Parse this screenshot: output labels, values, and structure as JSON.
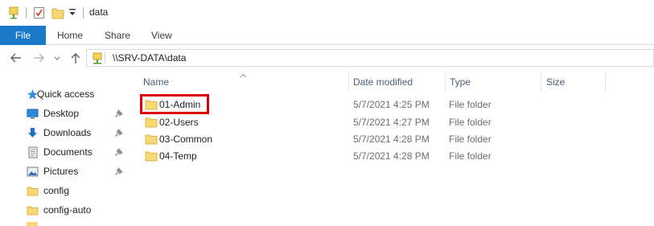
{
  "titlebar": {
    "title": "data",
    "icons": [
      "properties-icon",
      "checkmark-icon",
      "new-folder-icon",
      "customize-dropdown-icon"
    ]
  },
  "ribbon": {
    "tabs": [
      "File",
      "Home",
      "Share",
      "View"
    ]
  },
  "address": {
    "path": "\\\\SRV-DATA\\data"
  },
  "nav": {
    "items": [
      {
        "label": "Quick access",
        "icon": "star-icon",
        "pinned": false
      },
      {
        "label": "Desktop",
        "icon": "desktop-icon",
        "pinned": true
      },
      {
        "label": "Downloads",
        "icon": "download-arrow-icon",
        "pinned": true
      },
      {
        "label": "Documents",
        "icon": "documents-icon",
        "pinned": true
      },
      {
        "label": "Pictures",
        "icon": "pictures-icon",
        "pinned": true
      },
      {
        "label": "config",
        "icon": "folder-icon",
        "pinned": false
      },
      {
        "label": "config-auto",
        "icon": "folder-icon",
        "pinned": false
      }
    ]
  },
  "columns": {
    "name": "Name",
    "date": "Date modified",
    "type": "Type",
    "size": "Size"
  },
  "files": [
    {
      "name": "01-Admin",
      "date": "5/7/2021 4:25 PM",
      "type": "File folder"
    },
    {
      "name": "02-Users",
      "date": "5/7/2021 4:27 PM",
      "type": "File folder"
    },
    {
      "name": "03-Common",
      "date": "5/7/2021 4:28 PM",
      "type": "File folder"
    },
    {
      "name": "04-Temp",
      "date": "5/7/2021 4:28 PM",
      "type": "File folder"
    }
  ],
  "colors": {
    "file_tab": "#1979ca",
    "highlight": "#e00000",
    "folder": "#f8d775"
  }
}
